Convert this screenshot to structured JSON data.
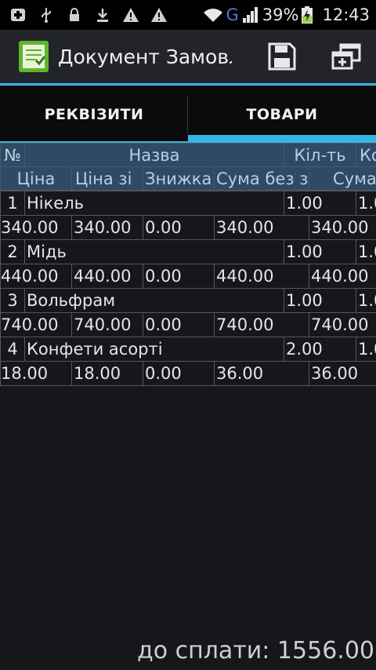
{
  "statusbar": {
    "network_type": "G",
    "battery_percent": "39%",
    "time": "12:43",
    "icons": [
      "plus-square-icon",
      "usb-icon",
      "lock-icon",
      "download-icon",
      "warning-icon",
      "warning-icon",
      "wifi-icon",
      "signal-icon",
      "battery-charging-icon"
    ]
  },
  "actionbar": {
    "title": "Документ Замовлення",
    "icons": [
      "app-document-icon",
      "save-icon",
      "copy-windows-icon"
    ]
  },
  "tabs": [
    "РЕКВІЗИТИ",
    "ТОВАРИ"
  ],
  "table": {
    "header_top": [
      "№",
      "Назва",
      "Кіл-ть",
      "Ко"
    ],
    "header_bottom": [
      "Ціна",
      "Ціна зі",
      "Знижка",
      "Сума без з",
      "Сума"
    ],
    "rows": [
      {
        "num": "1",
        "name": "Нікель",
        "qty": "1.00",
        "k": "1.0",
        "price": "340.00",
        "price_zi": "340.00",
        "discount": "0.00",
        "sum_without": "340.00",
        "sum": "340.00"
      },
      {
        "num": "2",
        "name": "Мідь",
        "qty": "1.00",
        "k": "1.0",
        "price": "440.00",
        "price_zi": "440.00",
        "discount": "0.00",
        "sum_without": "440.00",
        "sum": "440.00"
      },
      {
        "num": "3",
        "name": "Вольфрам",
        "qty": "1.00",
        "k": "1.0",
        "price": "740.00",
        "price_zi": "740.00",
        "discount": "0.00",
        "sum_without": "740.00",
        "sum": "740.00"
      },
      {
        "num": "4",
        "name": "Конфети асорті",
        "qty": "2.00",
        "k": "1.0",
        "price": "18.00",
        "price_zi": "18.00",
        "discount": "0.00",
        "sum_without": "36.00",
        "sum": "36.00"
      }
    ]
  },
  "footer": {
    "total_text": "до сплати: 1556.00"
  },
  "colors": {
    "accent": "#33b5e5",
    "header_bg": "#2e4a66",
    "header_text": "#b8cfe3"
  }
}
